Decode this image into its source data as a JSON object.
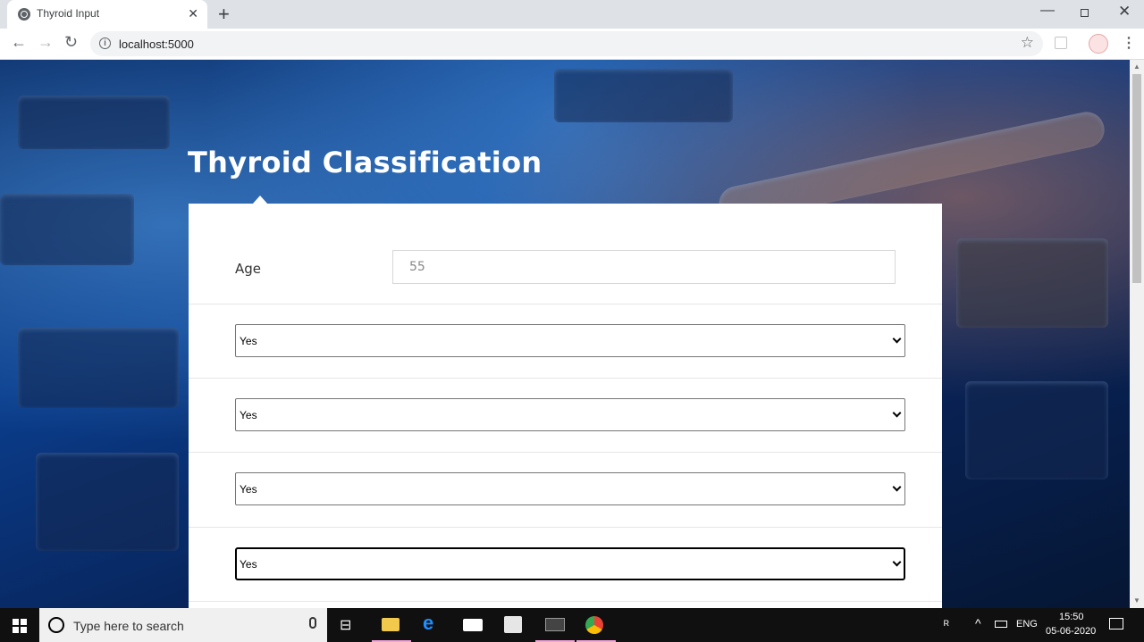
{
  "browser": {
    "tab_title": "Thyroid Input",
    "tab_close": "✕",
    "new_tab": "+",
    "url": "localhost:5000",
    "window_min": "—",
    "window_close": "✕"
  },
  "page": {
    "title": "Thyroid Classification",
    "age": {
      "label": "Age",
      "placeholder": "55"
    },
    "selects": [
      {
        "value": "Yes"
      },
      {
        "value": "Yes"
      },
      {
        "value": "Yes"
      },
      {
        "value": "Yes"
      }
    ]
  },
  "taskbar": {
    "search_placeholder": "Type here to search",
    "language": "ENG",
    "time": "15:50",
    "date": "05-06-2020"
  }
}
